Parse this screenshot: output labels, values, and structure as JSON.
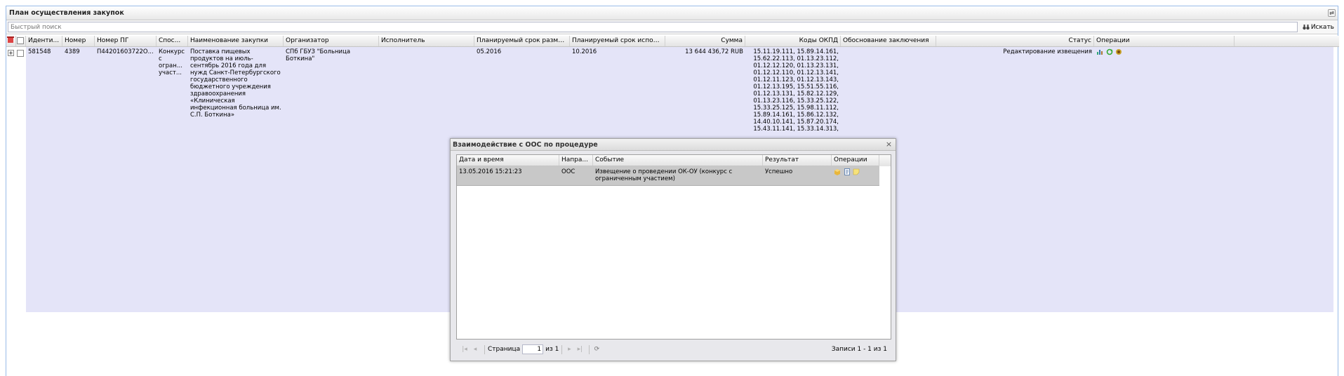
{
  "panel": {
    "title": "План осуществления закупок"
  },
  "search": {
    "placeholder": "Быстрый поиск",
    "button_label": "Искать"
  },
  "grid": {
    "columns": [
      "Иденти...",
      "Номер",
      "Номер ПГ",
      "Спос...",
      "Наименование закупки",
      "Организатор",
      "Исполнитель",
      "Планируемый срок размещ...",
      "Планируемый срок исполн...",
      "Сумма",
      "Коды ОКПД",
      "Обоснование заключения",
      "Статус",
      "Операции"
    ],
    "row": {
      "id": "581548",
      "number": "4389",
      "pg_number": "П44201603722О...",
      "method": "Конкурс с огран... участ...",
      "name": "Поставка пищевых продуктов на июль-сентябрь 2016 года для нужд Санкт-Петербургского государственного бюджетного учреждения здравоохранения «Клиническая инфекционная больница им. С.П. Боткина»",
      "organizer": "СПб ГБУЗ \"Больница Боткина\"",
      "executor": "",
      "placement_date": "05.2016",
      "execution_date": "10.2016",
      "amount": "13 644 436,72 RUB",
      "okpd_codes": "15.11.19.111, 15.89.14.161, 15.62.22.113, 01.13.23.112, 01.12.12.120, 01.13.23.131, 01.12.12.110, 01.12.13.141, 01.12.11.123, 01.12.13.143, 01.12.13.195, 15.51.55.116, 01.12.13.131, 15.82.12.129, 01.13.23.116, 15.33.25.122, 15.33.25.125, 15.98.11.112, 15.89.14.161, 15.86.12.132, 14.40.10.141, 15.87.20.174, 15.43.11.141, 15.33.14.313,",
      "justification": "",
      "status": "Редактирование извещения"
    }
  },
  "window": {
    "title": "Взаимодействие с ООС по процедуре",
    "columns": [
      "Дата и время",
      "Напра...",
      "Событие",
      "Результат",
      "Операции"
    ],
    "rows": [
      {
        "datetime": "13.05.2016 15:21:23",
        "direction": "ООС",
        "event": "Извещение о проведении ОК-ОУ (конкурс с ограниченным участием)",
        "result": "Успешно"
      }
    ],
    "pager": {
      "page_label": "Страница",
      "page_value": "1",
      "of_label": "из 1",
      "records": "Записи 1 - 1 из 1"
    }
  },
  "colors": {
    "row_bg": "#e4e4f8",
    "selected_row_bg": "#c8c8c8",
    "border": "#99bbe8"
  }
}
